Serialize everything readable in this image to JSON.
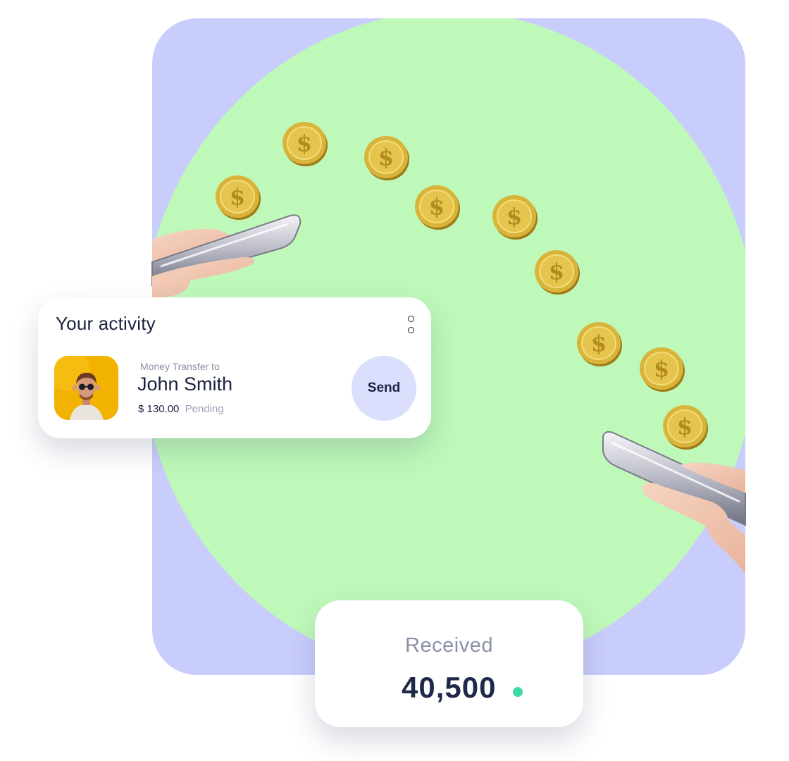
{
  "activity": {
    "title": "Your activity",
    "transfer_label": "Money Transfer to",
    "recipient": "John Smith",
    "amount": "$ 130.00",
    "status": "Pending",
    "send_label": "Send"
  },
  "received": {
    "label": "Received",
    "value": "40,500"
  },
  "coin_symbol": "$",
  "colors": {
    "background_card": "#c9cdfb",
    "circle": "#bff9b9",
    "send_button": "#dcdefd",
    "status_dot": "#3ddba3",
    "avatar_bg": "#f3b400",
    "text_dark": "#1c2240"
  },
  "icons": {
    "more": "more-vertical-icon",
    "coin": "dollar-coin-icon"
  }
}
